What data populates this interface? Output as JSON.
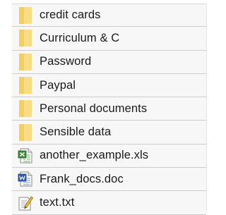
{
  "items": [
    {
      "label": "credit cards",
      "type": "folder",
      "icon": "folder-icon"
    },
    {
      "label": "Curriculum & C",
      "type": "folder",
      "icon": "folder-icon"
    },
    {
      "label": "Password",
      "type": "folder",
      "icon": "folder-icon"
    },
    {
      "label": "Paypal",
      "type": "folder",
      "icon": "folder-icon"
    },
    {
      "label": "Personal documents",
      "type": "folder",
      "icon": "folder-icon"
    },
    {
      "label": "Sensible data",
      "type": "folder",
      "icon": "folder-icon"
    },
    {
      "label": "another_example.xls",
      "type": "excel-file",
      "icon": "excel-file-icon"
    },
    {
      "label": "Frank_docs.doc",
      "type": "word-file",
      "icon": "word-file-icon"
    },
    {
      "label": "text.txt",
      "type": "text-file",
      "icon": "text-file-icon"
    }
  ],
  "colors": {
    "folder": "#f7d774",
    "folder_tab": "#efc94a",
    "excel_green": "#3a8e3a",
    "word_blue": "#2f5cae",
    "row_border": "#cccccc"
  }
}
